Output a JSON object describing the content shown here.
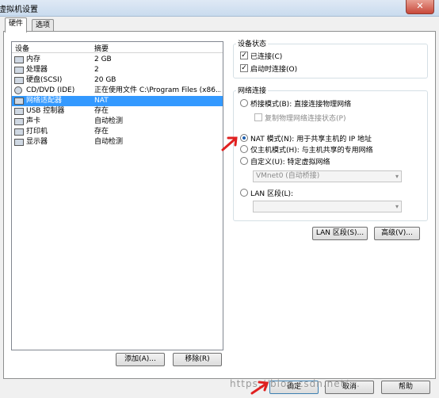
{
  "window": {
    "title": "虚拟机设置",
    "close_label": "✕"
  },
  "tabs": [
    {
      "label": "硬件"
    },
    {
      "label": "选项"
    }
  ],
  "device_list": {
    "headers": {
      "device": "设备",
      "summary": "摘要"
    },
    "rows": [
      {
        "name": "内存",
        "summary": "2 GB",
        "icon": "memory-icon"
      },
      {
        "name": "处理器",
        "summary": "2",
        "icon": "cpu-icon"
      },
      {
        "name": "硬盘(SCSI)",
        "summary": "20 GB",
        "icon": "hard-disk-icon"
      },
      {
        "name": "CD/DVD (IDE)",
        "summary": "正在使用文件 C:\\Program Files (x86...",
        "icon": "cd-dvd-icon"
      },
      {
        "name": "网络适配器",
        "summary": "NAT",
        "icon": "network-adapter-icon"
      },
      {
        "name": "USB 控制器",
        "summary": "存在",
        "icon": "usb-icon"
      },
      {
        "name": "声卡",
        "summary": "自动检测",
        "icon": "sound-card-icon"
      },
      {
        "name": "打印机",
        "summary": "存在",
        "icon": "printer-icon"
      },
      {
        "name": "显示器",
        "summary": "自动检测",
        "icon": "monitor-icon"
      }
    ],
    "selected_index": 4
  },
  "list_buttons": {
    "add": "添加(A)...",
    "remove": "移除(R)"
  },
  "device_status": {
    "title": "设备状态",
    "connected": "已连接(C)",
    "connect_at_power_on": "启动时连接(O)"
  },
  "network_connection": {
    "title": "网络连接",
    "bridged": "桥接模式(B): 直接连接物理网络",
    "replicate_state": "复制物理网络连接状态(P)",
    "nat": "NAT 模式(N): 用于共享主机的 IP 地址",
    "host_only": "仅主机模式(H): 与主机共享的专用网络",
    "custom": "自定义(U): 特定虚拟网络",
    "custom_value": "VMnet0 (自动桥接)",
    "lan_segment": "LAN 区段(L):",
    "lan_segment_value": ""
  },
  "action_buttons": {
    "lan_segments": "LAN 区段(S)...",
    "advanced": "高级(V)..."
  },
  "dialog_buttons": {
    "ok": "确定",
    "cancel": "取消",
    "help": "帮助"
  },
  "watermark": "https://blog.csdn.net/..."
}
